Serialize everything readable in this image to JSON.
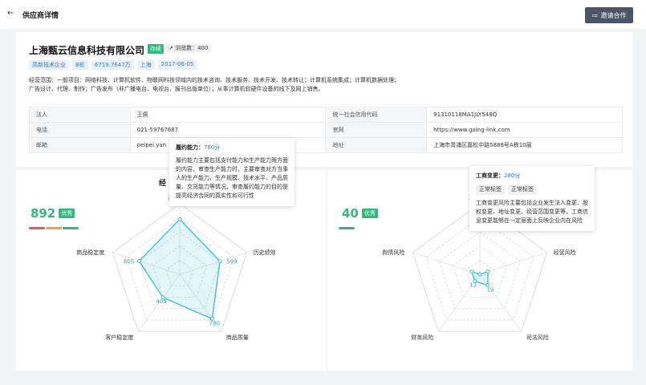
{
  "header": {
    "back_icon": "arrow-left-icon",
    "title": "供应商详情",
    "invite_button": "邀请合作"
  },
  "company": {
    "name": "上海甄云信息科技有限公司",
    "status": "存续",
    "views": "浏览数：400",
    "tags": [
      "高新技术企业",
      "B轮",
      "6719.7647万",
      "上海",
      "2017-06-05"
    ],
    "scope_line1": "经营范围：一般项目：网络科技、计算机软件、物联网科技领域内的技术咨询、技术服务、技术开发、技术转让；计算机系统集成；计算机数据处理；",
    "scope_line2": "广告设计、代理、制作；广告发布（非广播电台、电视台、报刊出版单位）；从事计算机软硬件设备的线下及网上销售。",
    "rows": [
      {
        "l1": "法人",
        "v1": "王佩",
        "l2": "统一社会信用代码",
        "v2": "91310118MA1JLY548Q"
      },
      {
        "l1": "电话",
        "v1": "021-59767687",
        "l2": "官网",
        "v2": "https://www.going-link.com"
      },
      {
        "l1": "邮箱",
        "v1": "peipei.yan",
        "l2": "地址",
        "v2": "上海市青浦区嘉松中路5888号A栋10层"
      }
    ]
  },
  "left_panel": {
    "title": "经",
    "score": "892",
    "score_tag": "优秀"
  },
  "right_panel": {
    "score": "40",
    "score_tag": "优秀"
  },
  "tooltip_left": {
    "label": "履约能力：",
    "value": "780分",
    "body": "履约能力主要包括支付能力和生产能力两方面的内容，审查生产能力时，主要审查对方当事人的生产能力、生产规模、技术水平、产品质量、交货能力等情况，审查履约能力的目的是提高经济合同的真实性和可行性"
  },
  "tooltip_right": {
    "label": "工商变更：",
    "value": "280分",
    "tags": [
      "正常标签",
      "正常标签"
    ],
    "body": "工商变更风险主要包括企业发生法人变更、股权变更、地址变更、经营范围变更等，工商信息变更能够在一定层面上反映企业内在风险"
  },
  "chart_data": [
    {
      "type": "radar",
      "categories": [
        "履约能力",
        "历史绩效",
        "商品质量",
        "客户稳定度",
        "商品稳定度"
      ],
      "values": [
        780,
        599,
        780,
        405,
        605
      ],
      "value_labels": [
        "",
        "599",
        "780",
        "405",
        "605"
      ],
      "max": 1000,
      "accent": "#3fc1d6"
    },
    {
      "type": "radar",
      "categories": [
        "工商变更",
        "经营风险",
        "司法风险",
        "财务风险",
        "舆情风险"
      ],
      "values": [
        0,
        12,
        19,
        12,
        12
      ],
      "value_labels": [
        "",
        "",
        "19",
        "12",
        ""
      ],
      "max": 100,
      "accent": "#3fc1d6"
    }
  ],
  "colors": {
    "green": "#2fb97c",
    "accent": "#3fc1d6",
    "bar_red": "#e05a4f",
    "bar_orange": "#f2a33a"
  }
}
